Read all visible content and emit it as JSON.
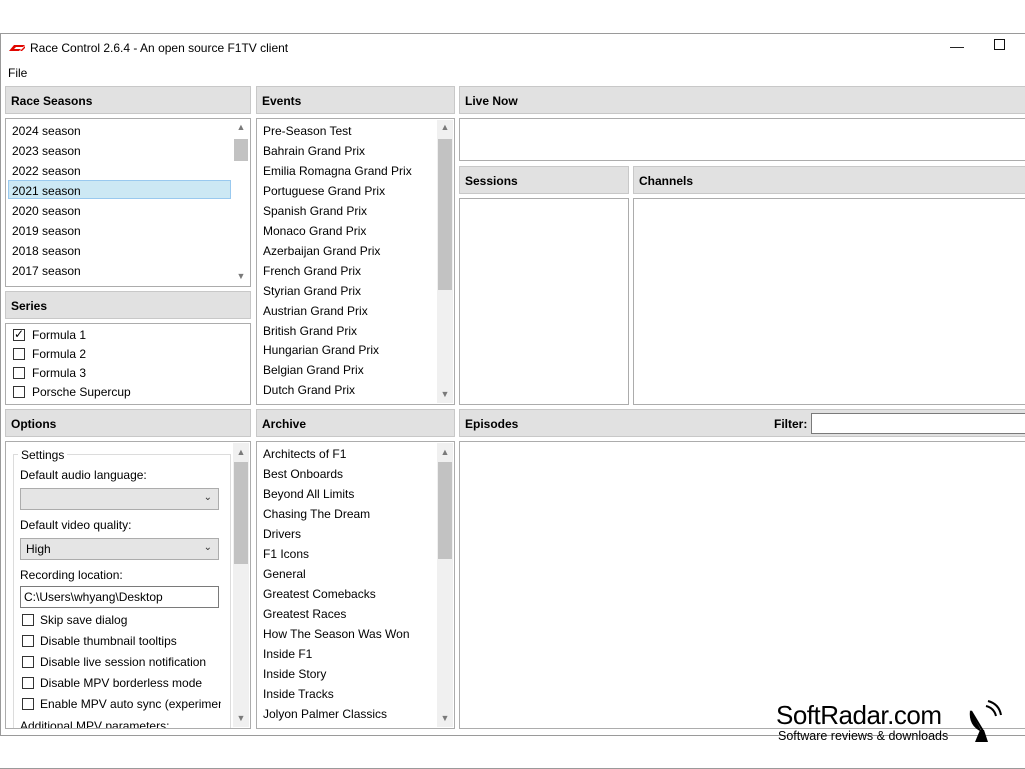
{
  "window": {
    "title": "Race Control 2.6.4 - An open source F1TV client",
    "minimize_glyph": "—",
    "maximize_glyph": "☐",
    "accent_color": "#e10600"
  },
  "menu": {
    "file": "File"
  },
  "race_seasons": {
    "header": "Race Seasons",
    "items": [
      "2024 season",
      "2023 season",
      "2022 season",
      "2021 season",
      "2020 season",
      "2019 season",
      "2018 season",
      "2017 season"
    ],
    "selected": "2021 season"
  },
  "series": {
    "header": "Series",
    "items": [
      {
        "label": "Formula 1",
        "checked": true
      },
      {
        "label": "Formula 2",
        "checked": false
      },
      {
        "label": "Formula 3",
        "checked": false
      },
      {
        "label": "Porsche Supercup",
        "checked": false
      }
    ]
  },
  "events": {
    "header": "Events",
    "items": [
      "Pre-Season Test",
      "Bahrain Grand Prix",
      "Emilia Romagna Grand Prix",
      "Portuguese Grand Prix",
      "Spanish Grand Prix",
      "Monaco Grand Prix",
      "Azerbaijan Grand Prix",
      "French Grand Prix",
      "Styrian Grand Prix",
      "Austrian Grand Prix",
      "British Grand Prix",
      "Hungarian Grand Prix",
      "Belgian Grand Prix",
      "Dutch Grand Prix"
    ]
  },
  "live_now": {
    "header": "Live Now"
  },
  "sessions": {
    "header": "Sessions"
  },
  "channels": {
    "header": "Channels"
  },
  "options": {
    "header": "Options",
    "settings_group": "Settings",
    "audio_language_label": "Default audio language:",
    "audio_language_value": "",
    "video_quality_label": "Default video quality:",
    "video_quality_value": "High",
    "recording_location_label": "Recording location:",
    "recording_location_value": "C:\\Users\\whyang\\Desktop",
    "checkboxes": [
      {
        "label": "Skip save dialog",
        "checked": false
      },
      {
        "label": "Disable thumbnail tooltips",
        "checked": false
      },
      {
        "label": "Disable live session notification",
        "checked": false
      },
      {
        "label": "Disable MPV borderless mode",
        "checked": false
      },
      {
        "label": "Enable MPV auto sync (experimen",
        "checked": false
      }
    ],
    "mpv_params_label": "Additional MPV parameters:"
  },
  "archive": {
    "header": "Archive",
    "items": [
      "Architects of F1",
      "Best Onboards",
      "Beyond All Limits",
      "Chasing The Dream",
      "Drivers",
      "F1 Icons",
      "General",
      "Greatest Comebacks",
      "Greatest Races",
      "How The Season Was Won",
      "Inside F1",
      "Inside Story",
      "Inside Tracks",
      "Jolyon Palmer Classics"
    ]
  },
  "episodes": {
    "header": "Episodes",
    "filter_label": "Filter:",
    "filter_value": ""
  },
  "watermark": {
    "brand": "SoftRadar.com",
    "tagline": "Software reviews & downloads"
  },
  "icons": {
    "check": "✓",
    "chevron_down": "⌄",
    "arrow_up": "▲",
    "arrow_down": "▼"
  }
}
